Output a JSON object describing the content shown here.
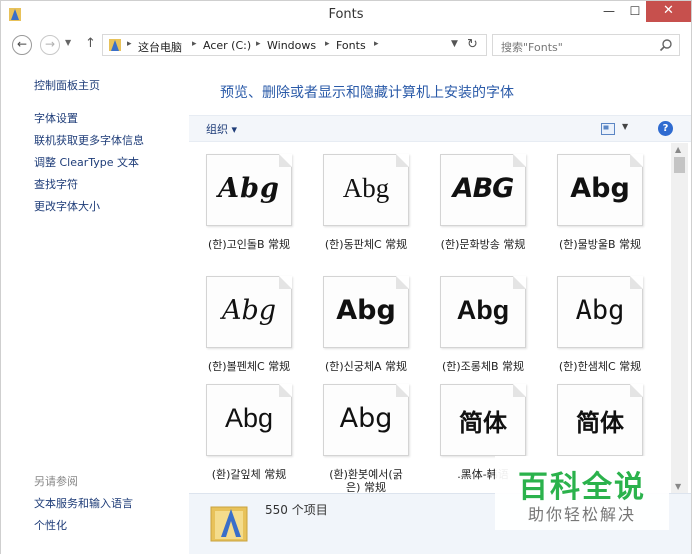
{
  "window": {
    "title": "Fonts",
    "minimize": "—",
    "maximize": "☐",
    "close": "✕"
  },
  "nav": {
    "back": "←",
    "forward": "→",
    "up": "↑",
    "refresh": "↻",
    "breadcrumb": [
      "这台电脑",
      "Acer (C:)",
      "Windows",
      "Fonts"
    ],
    "search_placeholder": "搜索\"Fonts\""
  },
  "sidebar": {
    "home": "控制面板主页",
    "links": [
      "字体设置",
      "联机获取更多字体信息",
      "调整 ClearType 文本",
      "查找字符",
      "更改字体大小"
    ],
    "see_also_heading": "另请参阅",
    "see_also": [
      "文本服务和输入语言",
      "个性化"
    ]
  },
  "main": {
    "title": "预览、删除或者显示和隐藏计算机上安装的字体",
    "organize": "组织 ▾",
    "help": "?"
  },
  "fonts": [
    {
      "sample": "Abg",
      "label": "(한)고인돌B 常规"
    },
    {
      "sample": "Abg",
      "label": "(한)동판체C 常规"
    },
    {
      "sample": "ABG",
      "label": "(한)문화방송 常规"
    },
    {
      "sample": "Abg",
      "label": "(한)물방울B 常规"
    },
    {
      "sample": "Abg",
      "label": "(한)볼펜체C 常规"
    },
    {
      "sample": "Abg",
      "label": "(한)신궁체A 常规"
    },
    {
      "sample": "Abg",
      "label": "(한)조롱체B 常规"
    },
    {
      "sample": "Abg",
      "label": "(한)한샘체C 常规"
    },
    {
      "sample": "Abg",
      "label": "(환)갈잎체 常规"
    },
    {
      "sample": "Abg",
      "label": "(환)환봇예서(굵은) 常规"
    },
    {
      "sample": "简体",
      "label": ".黑体-韩语"
    },
    {
      "sample": "简体",
      "label": ""
    }
  ],
  "details": {
    "count": "550 个项目"
  },
  "watermark": {
    "main": "百科全说",
    "sub": "助你轻松解决"
  },
  "colors": {
    "accent": "#2a5aa8",
    "link": "#1e3c78",
    "close": "#c7504d",
    "watermark": "#2bb24c"
  }
}
